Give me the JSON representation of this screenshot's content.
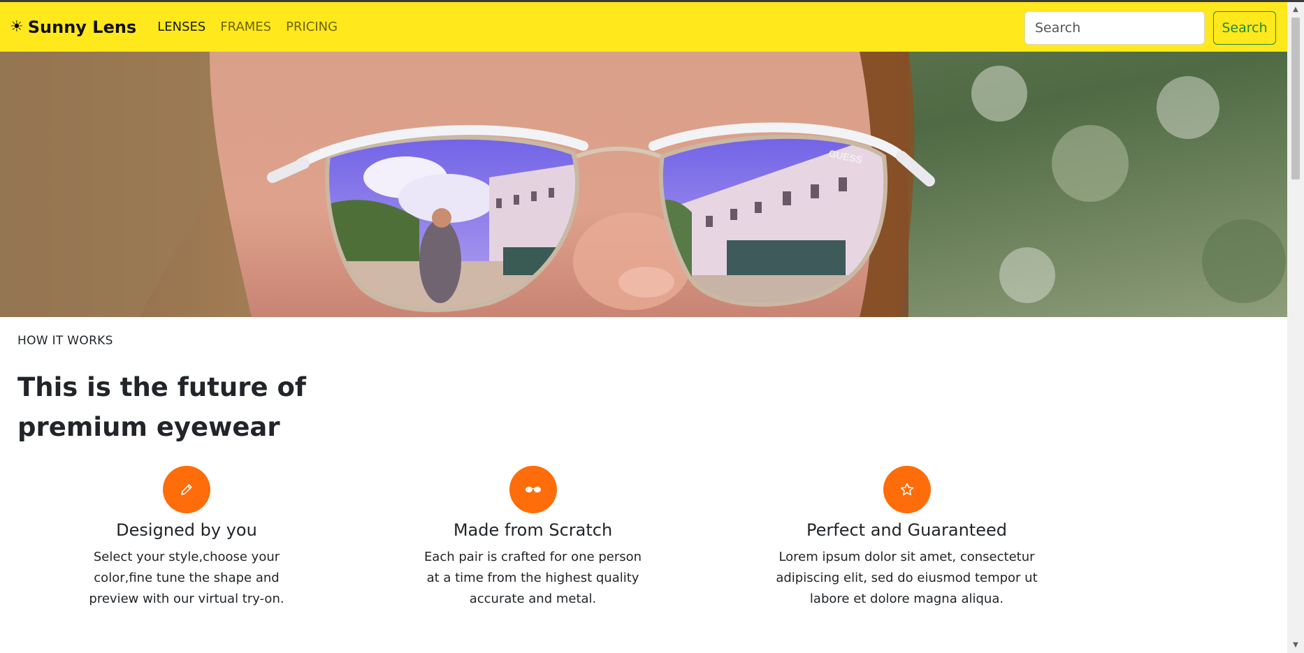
{
  "navbar": {
    "brand_icon": "☀",
    "brand": "Sunny Lens",
    "links": [
      {
        "label": "LENSES",
        "active": true
      },
      {
        "label": "FRAMES",
        "active": false
      },
      {
        "label": "PRICING",
        "active": false
      }
    ],
    "search_placeholder": "Search",
    "search_button": "Search"
  },
  "hero": {
    "image": "close-up photo of a face wearing mirrored sunglasses reflecting a villa and blue sky",
    "frame_brand": "GUESS"
  },
  "section": {
    "eyebrow": "HOW IT WORKS",
    "headline": "This is the future of premium eyewear"
  },
  "features": [
    {
      "icon": "pencil-icon",
      "title": "Designed by you",
      "text": "Select your style,choose your color,fine tune the shape and preview with our virtual try-on."
    },
    {
      "icon": "glasses-icon",
      "title": "Made from Scratch",
      "text": "Each pair is crafted for one person at a time from the highest quality accurate and metal."
    },
    {
      "icon": "star-icon",
      "title": "Perfect and Guaranteed",
      "text": "Lorem ipsum dolor sit amet, consectetur adipiscing elit, sed do eiusmod tempor ut labore et dolore magna aliqua."
    }
  ],
  "colors": {
    "navbar_bg": "#ffe81c",
    "accent": "#ff6c0a",
    "search_button": "#1e8a3c"
  }
}
